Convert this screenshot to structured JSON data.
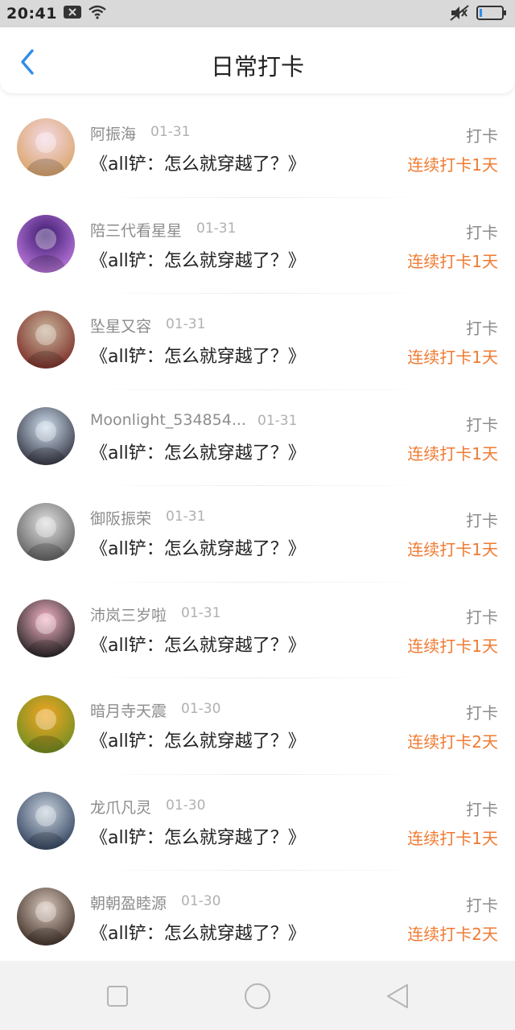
{
  "status_bar": {
    "time": "20:41",
    "icons": [
      "close-notification-icon",
      "wifi-icon",
      "mute-icon",
      "battery-icon"
    ]
  },
  "header": {
    "back_icon": "chevron-left-icon",
    "title": "日常打卡"
  },
  "checkins": [
    {
      "name": "阿振海",
      "date": "01-31",
      "book": "《all铲：怎么就穿越了？》",
      "action": "打卡",
      "streak": "连续打卡1天",
      "avatar_colors": [
        "#f4d9e6",
        "#d9a366"
      ]
    },
    {
      "name": "陪三代看星星",
      "date": "01-31",
      "book": "《all铲：怎么就穿越了？》",
      "action": "打卡",
      "streak": "连续打卡1天",
      "avatar_colors": [
        "#3a1a6e",
        "#c07be0"
      ]
    },
    {
      "name": "坠星又容",
      "date": "01-31",
      "book": "《all铲：怎么就穿越了？》",
      "action": "打卡",
      "streak": "连续打卡1天",
      "avatar_colors": [
        "#c8b49a",
        "#7a2a24"
      ]
    },
    {
      "name": "Moonlight_534854...",
      "date": "01-31",
      "book": "《all铲：怎么就穿越了？》",
      "action": "打卡",
      "streak": "连续打卡1天",
      "avatar_colors": [
        "#cfe0f0",
        "#2d2d3a"
      ]
    },
    {
      "name": "御阪振荣",
      "date": "01-31",
      "book": "《all铲：怎么就穿越了？》",
      "action": "打卡",
      "streak": "连续打卡1天",
      "avatar_colors": [
        "#e0e0e0",
        "#5a5a5a"
      ]
    },
    {
      "name": "沛岚三岁啦",
      "date": "01-31",
      "book": "《all铲：怎么就穿越了？》",
      "action": "打卡",
      "streak": "连续打卡1天",
      "avatar_colors": [
        "#f7b6c8",
        "#1a1a1a"
      ]
    },
    {
      "name": "暗月寺天震",
      "date": "01-30",
      "book": "《all铲：怎么就穿越了？》",
      "action": "打卡",
      "streak": "连续打卡2天",
      "avatar_colors": [
        "#f5a623",
        "#6b8e23"
      ]
    },
    {
      "name": "龙爪凡灵",
      "date": "01-30",
      "book": "《all铲：怎么就穿越了？》",
      "action": "打卡",
      "streak": "连续打卡1天",
      "avatar_colors": [
        "#c9d3de",
        "#2c3e5a"
      ]
    },
    {
      "name": "朝朝盈睦源",
      "date": "01-30",
      "book": "《all铲：怎么就穿越了？》",
      "action": "打卡",
      "streak": "连续打卡2天",
      "avatar_colors": [
        "#d8c8bc",
        "#3a2a22"
      ]
    }
  ],
  "nav_bar": {
    "icons": [
      "recent-apps-icon",
      "home-icon",
      "back-triangle-icon"
    ]
  },
  "colors": {
    "accent_blue": "#2f8ee6",
    "streak_orange": "#f07a31",
    "name_gray": "#8c8c8c",
    "date_gray": "#b0b0b0"
  }
}
